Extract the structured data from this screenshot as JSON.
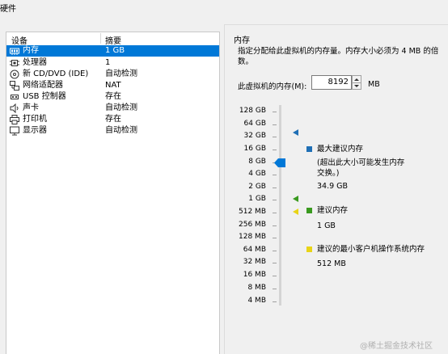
{
  "window": {
    "title": "硬件"
  },
  "hardware": {
    "col_device": "设备",
    "col_summary": "摘要",
    "items": [
      {
        "name": "内存",
        "summary": "1 GB",
        "icon": "memory-icon"
      },
      {
        "name": "处理器",
        "summary": "1",
        "icon": "cpu-icon"
      },
      {
        "name": "新 CD/DVD (IDE)",
        "summary": "自动检测",
        "icon": "cd-icon"
      },
      {
        "name": "网络适配器",
        "summary": "NAT",
        "icon": "network-icon"
      },
      {
        "name": "USB 控制器",
        "summary": "存在",
        "icon": "usb-icon"
      },
      {
        "name": "声卡",
        "summary": "自动检测",
        "icon": "speaker-icon"
      },
      {
        "name": "打印机",
        "summary": "存在",
        "icon": "printer-icon"
      },
      {
        "name": "显示器",
        "summary": "自动检测",
        "icon": "monitor-icon"
      }
    ],
    "selected_index": 0
  },
  "memory": {
    "group_title": "内存",
    "description": "指定分配给此虚拟机的内存量。内存大小必须为 4 MB 的倍数。",
    "field_label": "此虚拟机的内存(M):",
    "field_value": "8192",
    "unit": "MB",
    "scale": [
      "128 GB",
      "64 GB",
      "32 GB",
      "16 GB",
      "8 GB",
      "4 GB",
      "2 GB",
      "1 GB",
      "512 MB",
      "256 MB",
      "128 MB",
      "64 MB",
      "32 MB",
      "16 MB",
      "8 MB",
      "4 MB"
    ],
    "current_value_label": "8 GB",
    "max_recommended": {
      "label": "最大建议内存",
      "note": "(超出此大小可能发生内存交换。)",
      "value": "34.9 GB",
      "color": "#1f6fb5"
    },
    "recommended": {
      "label": "建议内存",
      "value": "1 GB",
      "color": "#3a9a1f"
    },
    "min_guest": {
      "label": "建议的最小客户机操作系统内存",
      "value": "512 MB",
      "color": "#e8d417"
    }
  },
  "watermark": "@稀土掘金技术社区",
  "colors": {
    "selection": "#0078d7",
    "panel_bg": "#f0f0f0"
  }
}
